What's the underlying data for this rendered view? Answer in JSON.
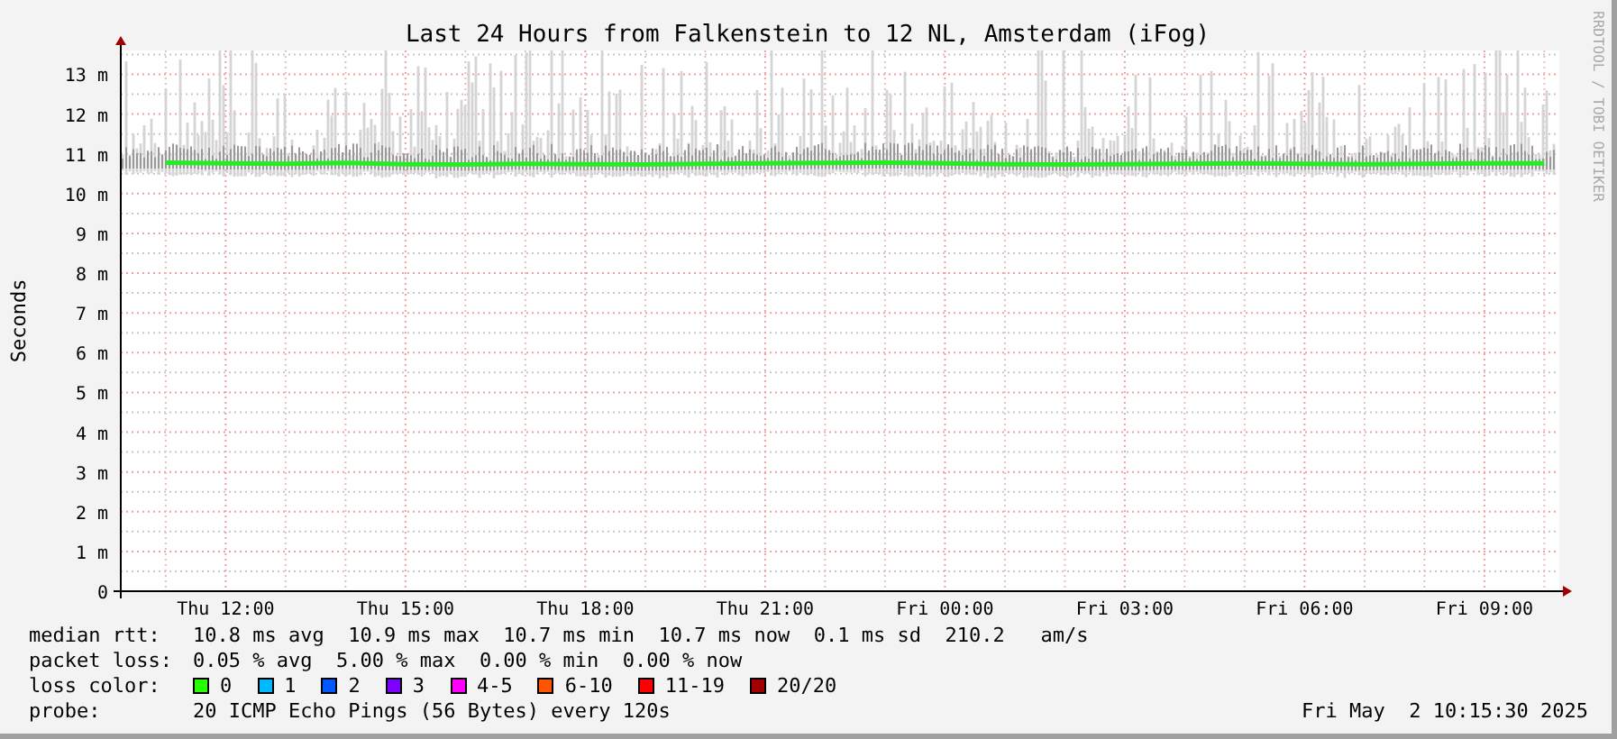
{
  "title": "Last 24 Hours from Falkenstein to 12 NL, Amsterdam (iFog)",
  "side_label": "RRDTOOL / TOBI OETIKER",
  "chart": {
    "chart_data": {
      "type": "line",
      "ylabel": "Seconds",
      "grid": true,
      "ylim": [
        0,
        13.6
      ],
      "categories": [
        null,
        "Thu 12:00",
        null,
        null,
        "Thu 15:00",
        null,
        null,
        "Thu 18:00",
        null,
        null,
        "Thu 21:00",
        null,
        null,
        "Fri 00:00",
        null,
        null,
        "Fri 03:00",
        null,
        null,
        "Fri 06:00",
        null,
        null,
        "Fri 09:00",
        null
      ],
      "yticks": [
        {
          "value": 0,
          "label": "0"
        },
        {
          "value": 1,
          "label": "1 m"
        },
        {
          "value": 2,
          "label": "2 m"
        },
        {
          "value": 3,
          "label": "3 m"
        },
        {
          "value": 4,
          "label": "4 m"
        },
        {
          "value": 5,
          "label": "5 m"
        },
        {
          "value": 6,
          "label": "6 m"
        },
        {
          "value": 7,
          "label": "7 m"
        },
        {
          "value": 8,
          "label": "8 m"
        },
        {
          "value": 9,
          "label": "9 m"
        },
        {
          "value": 10,
          "label": "10 m"
        },
        {
          "value": 11,
          "label": "11 m"
        },
        {
          "value": 12,
          "label": "12 m"
        },
        {
          "value": 13,
          "label": "13 m"
        }
      ],
      "series": [
        {
          "color": "#22ee22",
          "values": [
            10.78,
            10.76,
            10.75,
            10.77,
            10.74,
            10.73,
            10.75,
            10.74,
            10.73,
            10.75,
            10.76,
            10.77,
            10.78,
            10.76,
            10.74,
            10.73,
            10.74,
            10.75,
            10.76,
            10.75,
            10.74,
            10.75,
            10.76,
            10.76
          ]
        }
      ]
    }
  },
  "legend": [
    {
      "label": "median rtt:",
      "text": "10.8 ms avg  10.9 ms max  10.7 ms min  10.7 ms now  0.1 ms sd  210.2   am/s"
    },
    {
      "label": "packet loss:",
      "text": "0.05 % avg  5.00 % max  0.00 % min  0.00 % now"
    }
  ],
  "loss_color": {
    "label": "loss color:",
    "items": [
      {
        "label": "0",
        "color": "#26ff00"
      },
      {
        "label": "1",
        "color": "#00b8ff"
      },
      {
        "label": "2",
        "color": "#0059ff"
      },
      {
        "label": "3",
        "color": "#7e00ff"
      },
      {
        "label": "4-5",
        "color": "#ff00ff"
      },
      {
        "label": "6-10",
        "color": "#ff5500"
      },
      {
        "label": "11-19",
        "color": "#ff0000"
      },
      {
        "label": "20/20",
        "color": "#a10000"
      }
    ]
  },
  "probe": {
    "label": "probe:",
    "text": "20 ICMP Echo Pings (56 Bytes) every 120s"
  },
  "timestamp": "Fri May  2 10:15:30 2025"
}
